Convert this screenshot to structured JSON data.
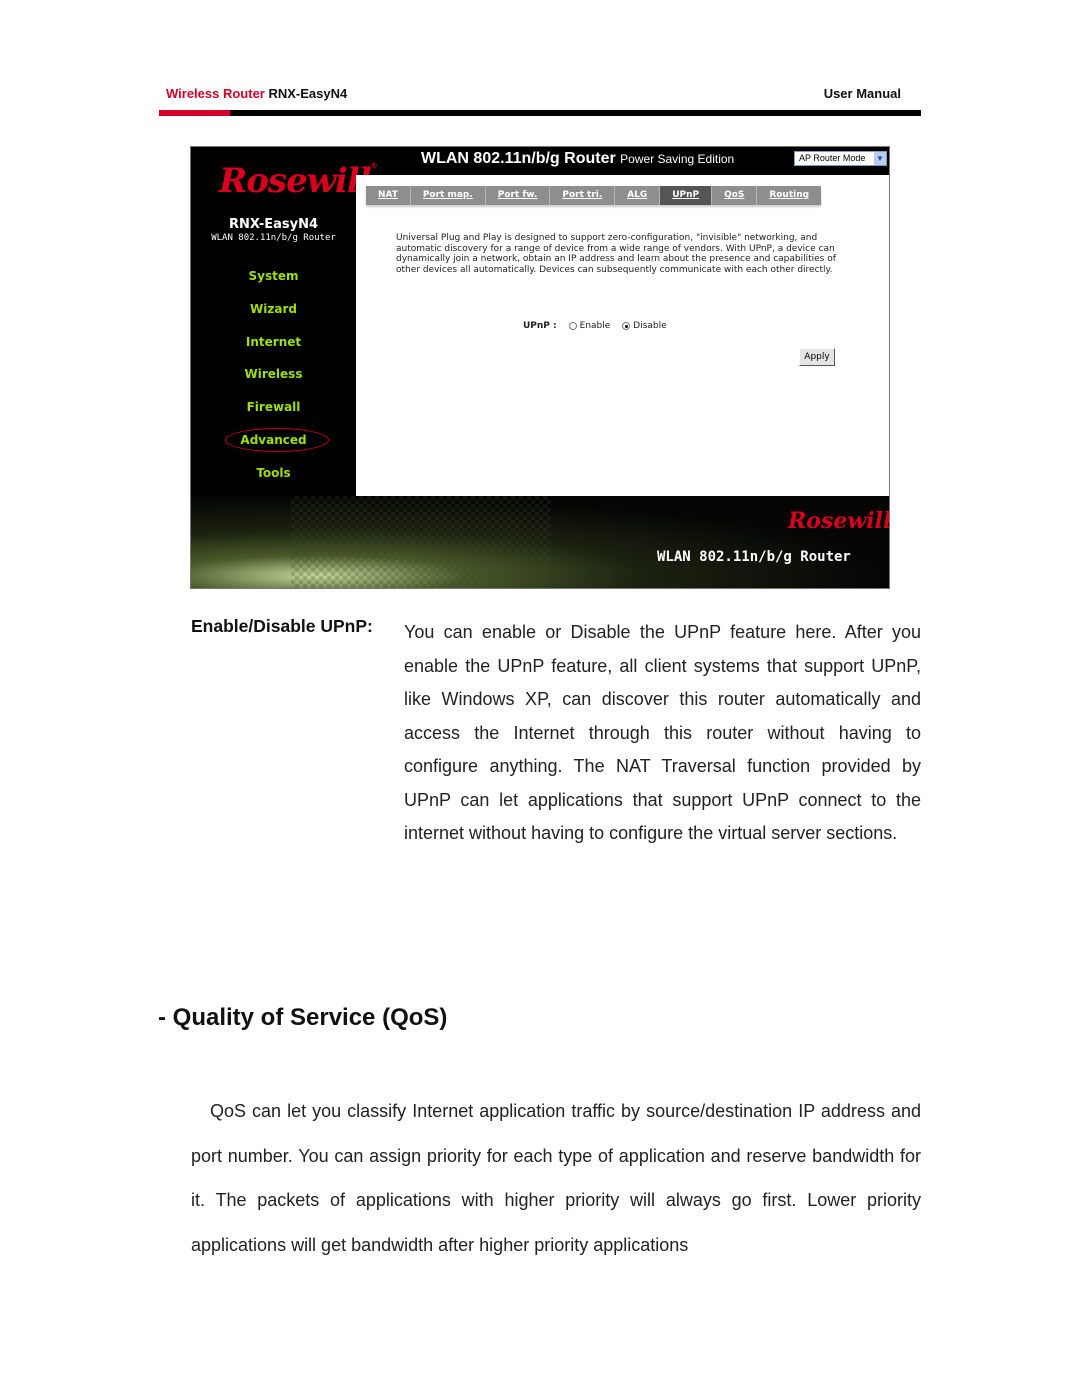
{
  "page_header": {
    "brand": "Wireless Router",
    "model": "RNX-EasyN4",
    "doc_type": "User Manual",
    "colors": {
      "brand_red": "#d4002a"
    }
  },
  "router_ui": {
    "logo": "Rosewill",
    "model_name": "RNX-EasyN4",
    "model_subtitle": "WLAN 802.11n/b/g Router",
    "banner_title": "WLAN 802.11n/b/g Router",
    "banner_subtitle": "Power Saving Edition",
    "mode_select": {
      "value": "AP Router Mode"
    },
    "nav": [
      {
        "label": "System"
      },
      {
        "label": "Wizard"
      },
      {
        "label": "Internet"
      },
      {
        "label": "Wireless"
      },
      {
        "label": "Firewall"
      },
      {
        "label": "Advanced",
        "active": true
      },
      {
        "label": "Tools"
      }
    ],
    "tabs": [
      {
        "label": "NAT"
      },
      {
        "label": "Port map."
      },
      {
        "label": "Port fw."
      },
      {
        "label": "Port tri."
      },
      {
        "label": "ALG"
      },
      {
        "label": "UPnP",
        "active": true
      },
      {
        "label": "QoS"
      },
      {
        "label": "Routing"
      }
    ],
    "description": "Universal Plug and Play is designed to support zero-configuration, \"invisible\" networking, and automatic discovery for a range of device from a wide range of vendors. With UPnP, a device can dynamically join a network, obtain an IP address and learn about the presence and capabilities of other devices all automatically. Devices can subsequently communicate with each other directly.",
    "upnp": {
      "label": "UPnP :",
      "options": [
        {
          "label": "Enable",
          "selected": false
        },
        {
          "label": "Disable",
          "selected": true
        }
      ]
    },
    "apply_label": "Apply",
    "footer_logo": "Rosewill",
    "footer_title": "WLAN 802.11n/b/g Router",
    "colors": {
      "nav_green": "#9ee000",
      "logo_red": "#d9001b",
      "active_ring": "#c00010"
    }
  },
  "definition": {
    "term": "Enable/Disable UPnP:",
    "body": "You can enable or Disable the UPnP feature here. After you enable the UPnP feature, all client systems that support UPnP, like Windows XP, can discover this router automatically and access the Internet through this router without having to configure anything. The NAT Traversal function provided by UPnP can let applications that support UPnP connect to the internet without having to configure the virtual server sections."
  },
  "section": {
    "title": "- Quality of Service (QoS)",
    "body": "QoS can let you classify Internet application traffic by source/destination IP address and port number. You can assign priority for each type of application and reserve bandwidth for it. The packets of applications with higher priority will always go first. Lower priority applications will get bandwidth after higher priority applications"
  }
}
